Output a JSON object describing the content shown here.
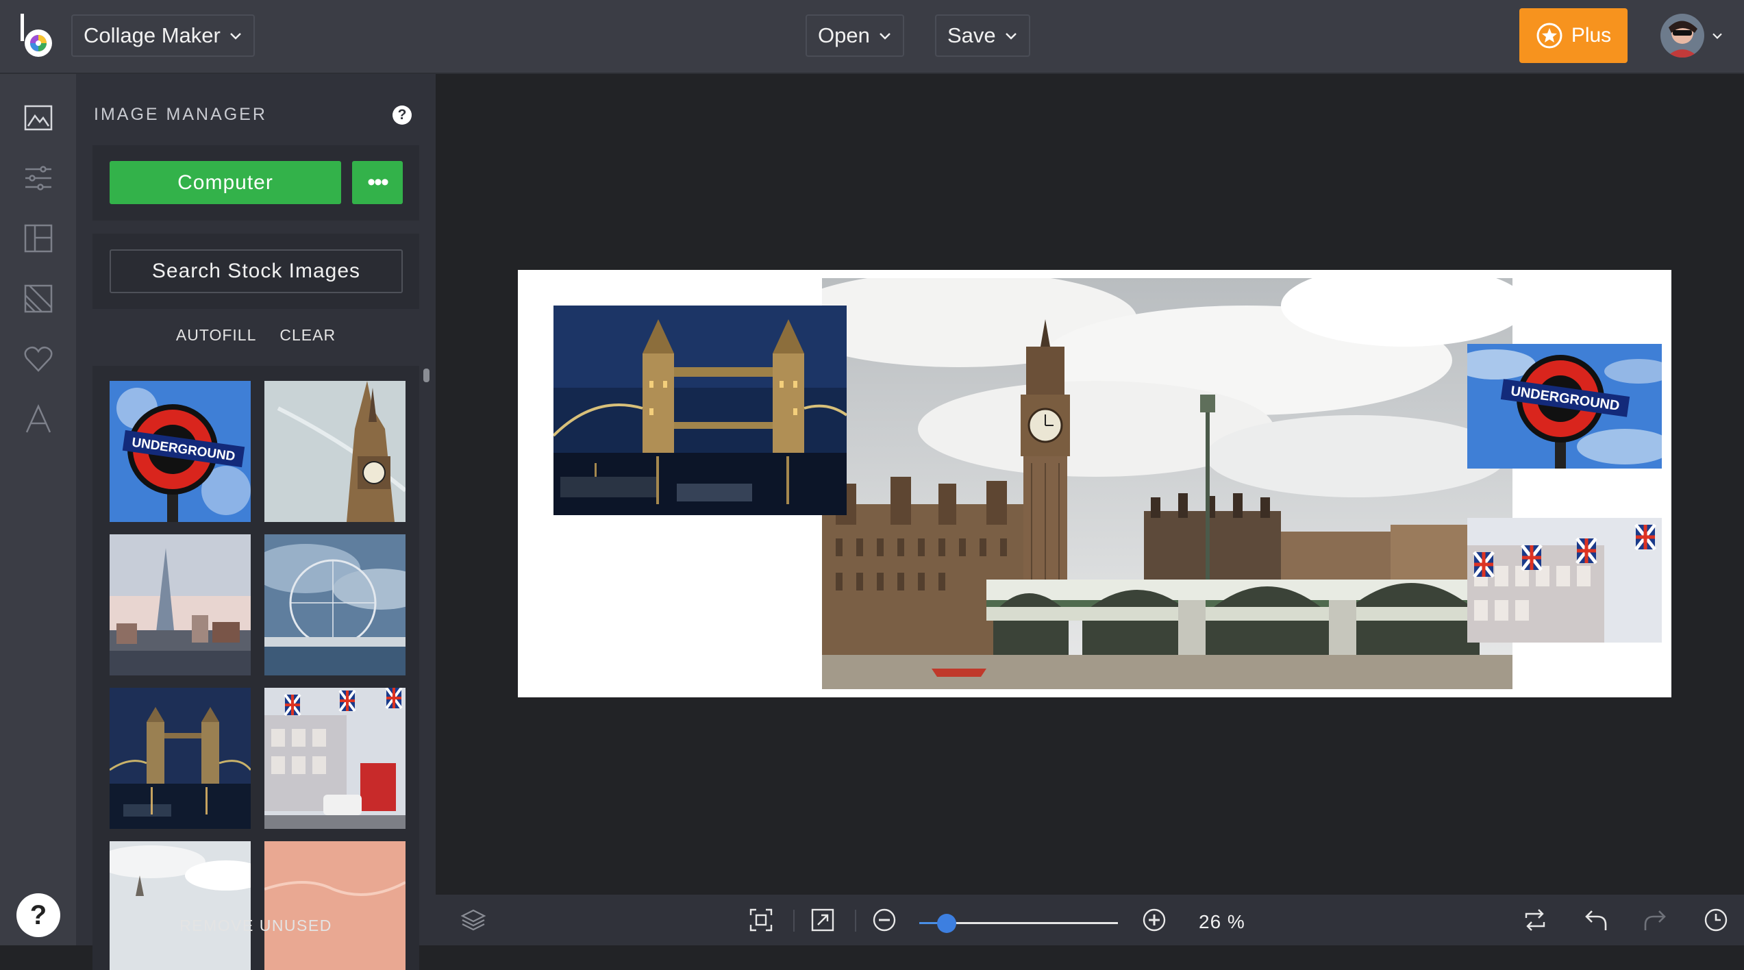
{
  "header": {
    "app_selector": "Collage Maker",
    "open_label": "Open",
    "save_label": "Save",
    "plus_label": "Plus"
  },
  "rail": {
    "icons": [
      "image-icon",
      "sliders-icon",
      "layout-icon",
      "background-icon",
      "heart-icon",
      "text-icon"
    ],
    "help_label": "?"
  },
  "panel": {
    "title": "IMAGE MANAGER",
    "help_label": "?",
    "computer_label": "Computer",
    "more_label": "•••",
    "stock_label": "Search Stock Images",
    "autofill_label": "AUTOFILL",
    "clear_label": "CLEAR",
    "remove_unused_label": "REMOVE UNUSED",
    "thumbnails": [
      "underground-sign",
      "big-ben-tower",
      "london-skyline-shard",
      "london-eye",
      "tower-bridge-night",
      "union-jack-street",
      "clouds-tower",
      "pink-sky"
    ]
  },
  "canvas": {
    "photos": [
      "tower-bridge-night",
      "westminster-big-ben",
      "underground-sign",
      "union-jack-flags"
    ]
  },
  "bottom": {
    "zoom_text": "26 %",
    "zoom_percent": 26
  },
  "colors": {
    "accent_green": "#33b24a",
    "plus_orange": "#f7931e",
    "slider_blue": "#3d7fe0"
  }
}
